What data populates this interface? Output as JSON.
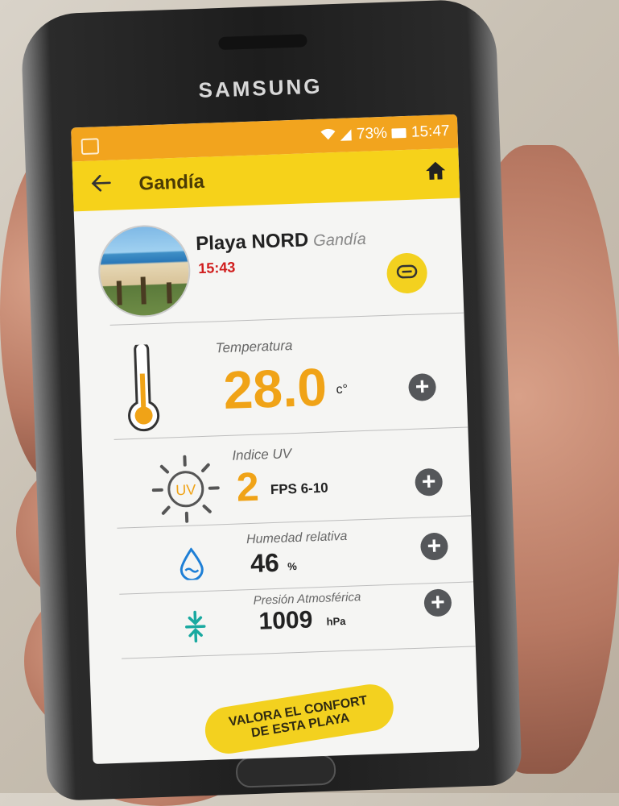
{
  "device": {
    "brand": "SAMSUNG"
  },
  "status_bar": {
    "battery": "73%",
    "time": "15:47"
  },
  "app_bar": {
    "title": "Gandía"
  },
  "beach": {
    "name": "Playa NORD",
    "city": "Gandía",
    "time": "15:43"
  },
  "metrics": {
    "temperature": {
      "label": "Temperatura",
      "value": "28.0",
      "unit": "c°"
    },
    "uv": {
      "label": "Indice UV",
      "value": "2",
      "detail": "FPS 6-10"
    },
    "humidity": {
      "label": "Humedad relativa",
      "value": "46",
      "unit": "%"
    },
    "pressure": {
      "label": "Presión Atmosférica",
      "value": "1009",
      "unit": "hPa"
    }
  },
  "cta": {
    "line1": "VALORA EL CONFORT",
    "line2": "DE ESTA PLAYA"
  },
  "icons": {
    "back": "arrow-left",
    "home": "home",
    "link": "link",
    "temperature": "thermometer",
    "uv": "sun-uv",
    "humidity": "water-drop",
    "pressure": "compress-arrows",
    "expand": "plus-circle"
  },
  "colors": {
    "status_bar": "#f2a41e",
    "app_bar": "#f6d21a",
    "accent_value": "#f0a317",
    "time_red": "#d01c1c",
    "plus_button": "#55575a"
  }
}
